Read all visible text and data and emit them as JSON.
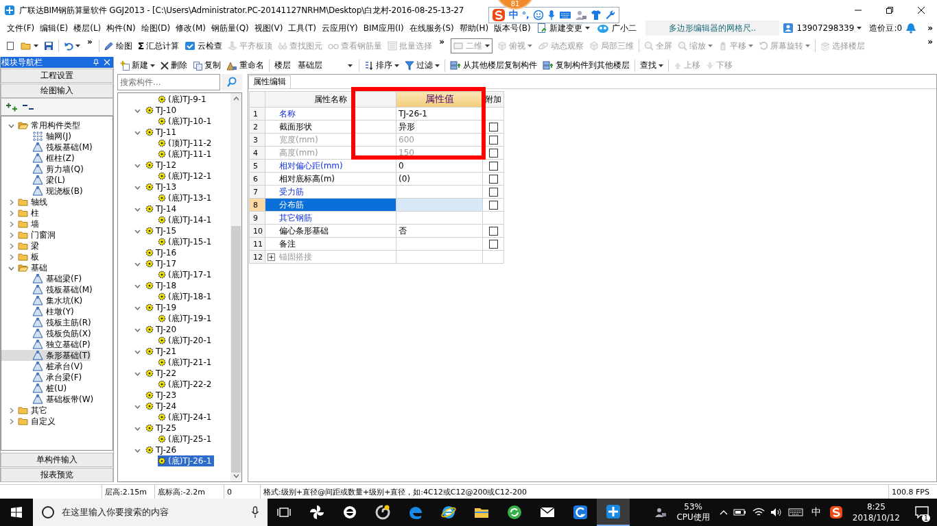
{
  "title_bar": {
    "title": "广联达BIM钢筋算量软件 GGJ2013 - [C:\\Users\\Administrator.PC-20141127NRHM\\Desktop\\白龙村-2016-08-25-13-27",
    "badge": "81"
  },
  "ime_bar": {
    "mode": "中",
    "punctuation": "°,"
  },
  "menu": {
    "items": [
      "文件(F)",
      "编辑(E)",
      "楼层(L)",
      "构件(N)",
      "绘图(D)",
      "修改(M)",
      "钢筋量(Q)",
      "视图(V)",
      "工具(T)",
      "云应用(Y)",
      "BIM应用(I)",
      "在线服务(S)",
      "帮助(H)",
      "版本号(B)"
    ],
    "change": "新建变更",
    "assistant": "广小二",
    "document_tab": "多边形编辑器的网格尺..",
    "account": "13907298339",
    "beans": "造价豆:0",
    "overflow": "»"
  },
  "toolbar_main": {
    "items": [
      {
        "kind": "icon",
        "disabled": false,
        "dropdown": false
      },
      {
        "kind": "icon",
        "disabled": false,
        "dropdown": true
      },
      {
        "kind": "icon",
        "disabled": false,
        "dropdown": false
      },
      {
        "kind": "separator"
      },
      {
        "kind": "icon",
        "disabled": false,
        "dropdown": true
      },
      {
        "kind": "more",
        "label": "»"
      },
      {
        "kind": "separator"
      },
      {
        "kind": "button",
        "label": "绘图",
        "disabled": false,
        "dropdown": false
      },
      {
        "kind": "button",
        "glyph": "Σ",
        "label": "汇总计算",
        "disabled": false,
        "dropdown": false
      },
      {
        "kind": "button",
        "label": "云检查",
        "disabled": false,
        "dropdown": false
      },
      {
        "kind": "button",
        "label": "平齐板顶",
        "disabled": true,
        "dropdown": false
      },
      {
        "kind": "button",
        "label": "查找图元",
        "disabled": true,
        "dropdown": false
      },
      {
        "kind": "button",
        "label": "查看钢筋量",
        "disabled": true,
        "dropdown": false
      },
      {
        "kind": "button",
        "label": "批量选择",
        "disabled": true,
        "dropdown": false
      },
      {
        "kind": "more",
        "label": "»"
      },
      {
        "kind": "combo",
        "value": "二维",
        "disabled": true
      },
      {
        "kind": "button",
        "label": "俯视",
        "disabled": true,
        "dropdown": true
      },
      {
        "kind": "button",
        "label": "动态观察",
        "disabled": true,
        "dropdown": false
      },
      {
        "kind": "button",
        "label": "局部三维",
        "disabled": true,
        "dropdown": false
      },
      {
        "kind": "separator"
      },
      {
        "kind": "button",
        "label": "全屏",
        "disabled": true,
        "dropdown": false
      },
      {
        "kind": "button",
        "label": "缩放",
        "disabled": true,
        "dropdown": true
      },
      {
        "kind": "button",
        "label": "平移",
        "disabled": true,
        "dropdown": true
      },
      {
        "kind": "button",
        "label": "屏幕旋转",
        "disabled": true,
        "dropdown": true
      },
      {
        "kind": "separator"
      },
      {
        "kind": "button",
        "label": "选择楼层",
        "disabled": true,
        "dropdown": false
      }
    ],
    "overflow": "»"
  },
  "navigator": {
    "title": "模块导航栏",
    "sections": [
      "工程设置",
      "绘图输入"
    ],
    "tree": [
      {
        "label": "常用构件类型",
        "expanded": true,
        "selected": false,
        "children": [
          {
            "label": "轴网(J)",
            "selected": false
          },
          {
            "label": "筏板基础(M)",
            "selected": false
          },
          {
            "label": "框柱(Z)",
            "selected": false
          },
          {
            "label": "剪力墙(Q)",
            "selected": false
          },
          {
            "label": "梁(L)",
            "selected": false
          },
          {
            "label": "现浇板(B)",
            "selected": false
          }
        ]
      },
      {
        "label": "轴线",
        "expanded": false,
        "selected": false
      },
      {
        "label": "柱",
        "expanded": false,
        "selected": false
      },
      {
        "label": "墙",
        "expanded": false,
        "selected": false
      },
      {
        "label": "门窗洞",
        "expanded": false,
        "selected": false
      },
      {
        "label": "梁",
        "expanded": false,
        "selected": false
      },
      {
        "label": "板",
        "expanded": false,
        "selected": false
      },
      {
        "label": "基础",
        "expanded": true,
        "selected": false,
        "children": [
          {
            "label": "基础梁(F)",
            "selected": false
          },
          {
            "label": "筏板基础(M)",
            "selected": false
          },
          {
            "label": "集水坑(K)",
            "selected": false
          },
          {
            "label": "柱墩(Y)",
            "selected": false
          },
          {
            "label": "筏板主筋(R)",
            "selected": false
          },
          {
            "label": "筏板负筋(X)",
            "selected": false
          },
          {
            "label": "独立基础(P)",
            "selected": false
          },
          {
            "label": "条形基础(T)",
            "selected": true
          },
          {
            "label": "桩承台(V)",
            "selected": false
          },
          {
            "label": "承台梁(F)",
            "selected": false
          },
          {
            "label": "桩(U)",
            "selected": false
          },
          {
            "label": "基础板带(W)",
            "selected": false
          }
        ]
      },
      {
        "label": "其它",
        "expanded": false,
        "selected": false
      },
      {
        "label": "自定义",
        "expanded": false,
        "selected": false
      }
    ],
    "bottom_sections": [
      "单构件输入",
      "报表预览"
    ]
  },
  "toolbar_components": {
    "items": [
      {
        "kind": "button",
        "label": "新建",
        "disabled": false,
        "dropdown": true
      },
      {
        "kind": "button",
        "label": "删除",
        "disabled": false,
        "dropdown": false
      },
      {
        "kind": "button",
        "label": "复制",
        "disabled": false,
        "dropdown": false
      },
      {
        "kind": "button",
        "label": "重命名",
        "disabled": false,
        "dropdown": false
      },
      {
        "kind": "separator"
      },
      {
        "kind": "label",
        "label": "楼层"
      },
      {
        "kind": "combo",
        "value": "基础层",
        "disabled": false
      },
      {
        "kind": "separator"
      },
      {
        "kind": "button",
        "label": "排序",
        "disabled": false,
        "dropdown": true
      },
      {
        "kind": "button",
        "label": "过滤",
        "disabled": false,
        "dropdown": true
      },
      {
        "kind": "separator"
      },
      {
        "kind": "button",
        "label": "从其他楼层复制构件",
        "disabled": false,
        "dropdown": false
      },
      {
        "kind": "button",
        "label": "复制构件到其他楼层",
        "disabled": false,
        "dropdown": false
      },
      {
        "kind": "separator"
      },
      {
        "kind": "button",
        "label": "查找",
        "disabled": false,
        "dropdown": true
      },
      {
        "kind": "separator"
      },
      {
        "kind": "button",
        "label": "上移",
        "disabled": true,
        "dropdown": false
      },
      {
        "kind": "button",
        "label": "下移",
        "disabled": true,
        "dropdown": false
      }
    ]
  },
  "component_list": {
    "search_placeholder": "搜索构件...",
    "tree": [
      {
        "children": [
          {
            "label": "(底)TJ-9-1",
            "selected": false
          }
        ]
      },
      {
        "label": "TJ-10",
        "expanded": true,
        "selected": false,
        "children": [
          {
            "label": "(底)TJ-10-1",
            "selected": false
          }
        ]
      },
      {
        "label": "TJ-11",
        "expanded": true,
        "selected": false,
        "children": [
          {
            "label": "(顶)TJ-11-2",
            "selected": false
          },
          {
            "label": "(底)TJ-11-1",
            "selected": false
          }
        ]
      },
      {
        "label": "TJ-12",
        "expanded": true,
        "selected": false,
        "children": [
          {
            "label": "(底)TJ-12-1",
            "selected": false
          }
        ]
      },
      {
        "label": "TJ-13",
        "expanded": true,
        "selected": false,
        "children": [
          {
            "label": "(底)TJ-13-1",
            "selected": false
          }
        ]
      },
      {
        "label": "TJ-14",
        "expanded": true,
        "selected": false,
        "children": [
          {
            "label": "(底)TJ-14-1",
            "selected": false
          }
        ]
      },
      {
        "label": "TJ-15",
        "expanded": true,
        "selected": false,
        "children": [
          {
            "label": "(底)TJ-15-1",
            "selected": false
          }
        ]
      },
      {
        "label": "TJ-16",
        "selected": false
      },
      {
        "label": "TJ-17",
        "expanded": true,
        "selected": false,
        "children": [
          {
            "label": "(底)TJ-17-1",
            "selected": false
          }
        ]
      },
      {
        "label": "TJ-18",
        "expanded": true,
        "selected": false,
        "children": [
          {
            "label": "(底)TJ-18-1",
            "selected": false
          }
        ]
      },
      {
        "label": "TJ-19",
        "expanded": true,
        "selected": false,
        "children": [
          {
            "label": "(底)TJ-19-1",
            "selected": false
          }
        ]
      },
      {
        "label": "TJ-20",
        "expanded": true,
        "selected": false,
        "children": [
          {
            "label": "(底)TJ-20-1",
            "selected": false
          }
        ]
      },
      {
        "label": "TJ-21",
        "expanded": true,
        "selected": false,
        "children": [
          {
            "label": "(底)TJ-21-1",
            "selected": false
          }
        ]
      },
      {
        "label": "TJ-22",
        "expanded": true,
        "selected": false,
        "children": [
          {
            "label": "(底)TJ-22-2",
            "selected": false
          }
        ]
      },
      {
        "label": "TJ-23",
        "selected": false
      },
      {
        "label": "TJ-24",
        "expanded": true,
        "selected": false,
        "children": [
          {
            "label": "(底)TJ-24-1",
            "selected": false
          }
        ]
      },
      {
        "label": "TJ-25",
        "expanded": true,
        "selected": false,
        "children": [
          {
            "label": "(底)TJ-25-1",
            "selected": false
          }
        ]
      },
      {
        "label": "TJ-26",
        "expanded": true,
        "selected": false,
        "children": [
          {
            "label": "(底)TJ-26-1",
            "selected": true
          }
        ]
      }
    ]
  },
  "properties": {
    "tab": "属性编辑",
    "columns": [
      {
        "label": "属性名称",
        "selected": false
      },
      {
        "label": "属性值",
        "selected": true
      },
      {
        "label": "附加",
        "selected": false
      }
    ],
    "rows": [
      {
        "number": "1",
        "name": "名称",
        "value": "TJ-26-1",
        "kind": "link",
        "selected": false
      },
      {
        "number": "2",
        "name": "截面形状",
        "value": "异形",
        "kind": "plain",
        "selected": false,
        "checked": false
      },
      {
        "number": "3",
        "name": "宽度(mm)",
        "value": "600",
        "kind": "disabled",
        "selected": false,
        "checked": false
      },
      {
        "number": "4",
        "name": "高度(mm)",
        "value": "150",
        "kind": "disabled",
        "selected": false,
        "checked": false
      },
      {
        "number": "5",
        "name": "相对偏心距(mm)",
        "value": "0",
        "kind": "link",
        "selected": false,
        "checked": false
      },
      {
        "number": "6",
        "name": "相对底标高(m)",
        "value": "(0)",
        "kind": "plain",
        "selected": false,
        "checked": false
      },
      {
        "number": "7",
        "name": "受力筋",
        "kind": "link",
        "selected": false,
        "checked": false
      },
      {
        "number": "8",
        "name": "分布筋",
        "kind": "link",
        "selected": true,
        "checked": false
      },
      {
        "number": "9",
        "name": "其它钢筋",
        "kind": "link",
        "selected": false
      },
      {
        "number": "10",
        "name": "偏心条形基础",
        "value": "否",
        "kind": "plain",
        "selected": false,
        "checked": false
      },
      {
        "number": "11",
        "name": "备注",
        "kind": "plain",
        "selected": false,
        "checked": false
      },
      {
        "number": "12",
        "name": "锚固搭接",
        "kind": "disabled",
        "selected": false,
        "expanded": false
      }
    ],
    "annotation": {
      "kind": "rectangle"
    }
  },
  "status_bar": [
    "层高:2.15m",
    "底标高:-2.2m",
    "0",
    "格式:级别+直径@间距或数量+级别+直径，如:4C12或C12@200或C12-200",
    "100.8 FPS"
  ],
  "taskbar": {
    "search_placeholder": "在这里输入你要搜索的内容",
    "apps": [
      {
        "active": false
      },
      {
        "active": false
      },
      {
        "active": false
      },
      {
        "active": false
      },
      {
        "active": false
      },
      {
        "active": false
      },
      {
        "active": false
      },
      {
        "active": false
      },
      {
        "active": false
      },
      {
        "active": true
      }
    ],
    "cpu_value": "53%",
    "cpu_label": "CPU使用",
    "input_mode": "中",
    "time": "8:25",
    "date": "2018/10/12",
    "notifications": "1"
  }
}
